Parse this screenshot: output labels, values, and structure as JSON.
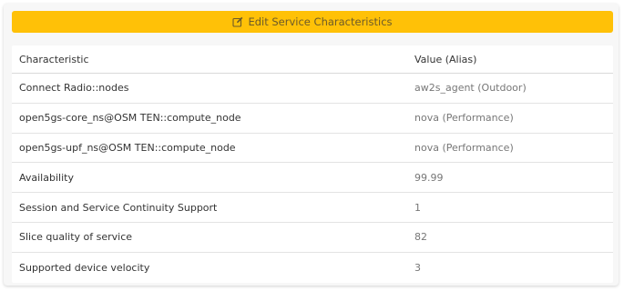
{
  "edit_button": {
    "label": "Edit Service Characteristics",
    "icon": "edit-icon",
    "color": "#ffc107"
  },
  "table": {
    "headers": {
      "characteristic": "Characteristic",
      "value": "Value (Alias)"
    },
    "rows": [
      {
        "characteristic": "Connect Radio::nodes",
        "value": "aw2s_agent (Outdoor)"
      },
      {
        "characteristic": "open5gs-core_ns@OSM TEN::compute_node",
        "value": "nova (Performance)"
      },
      {
        "characteristic": "open5gs-upf_ns@OSM TEN::compute_node",
        "value": "nova (Performance)"
      },
      {
        "characteristic": "Availability",
        "value": "99.99"
      },
      {
        "characteristic": "Session and Service Continuity Support",
        "value": "1"
      },
      {
        "characteristic": "Slice quality of service",
        "value": "82"
      },
      {
        "characteristic": "Supported device velocity",
        "value": "3"
      }
    ]
  }
}
